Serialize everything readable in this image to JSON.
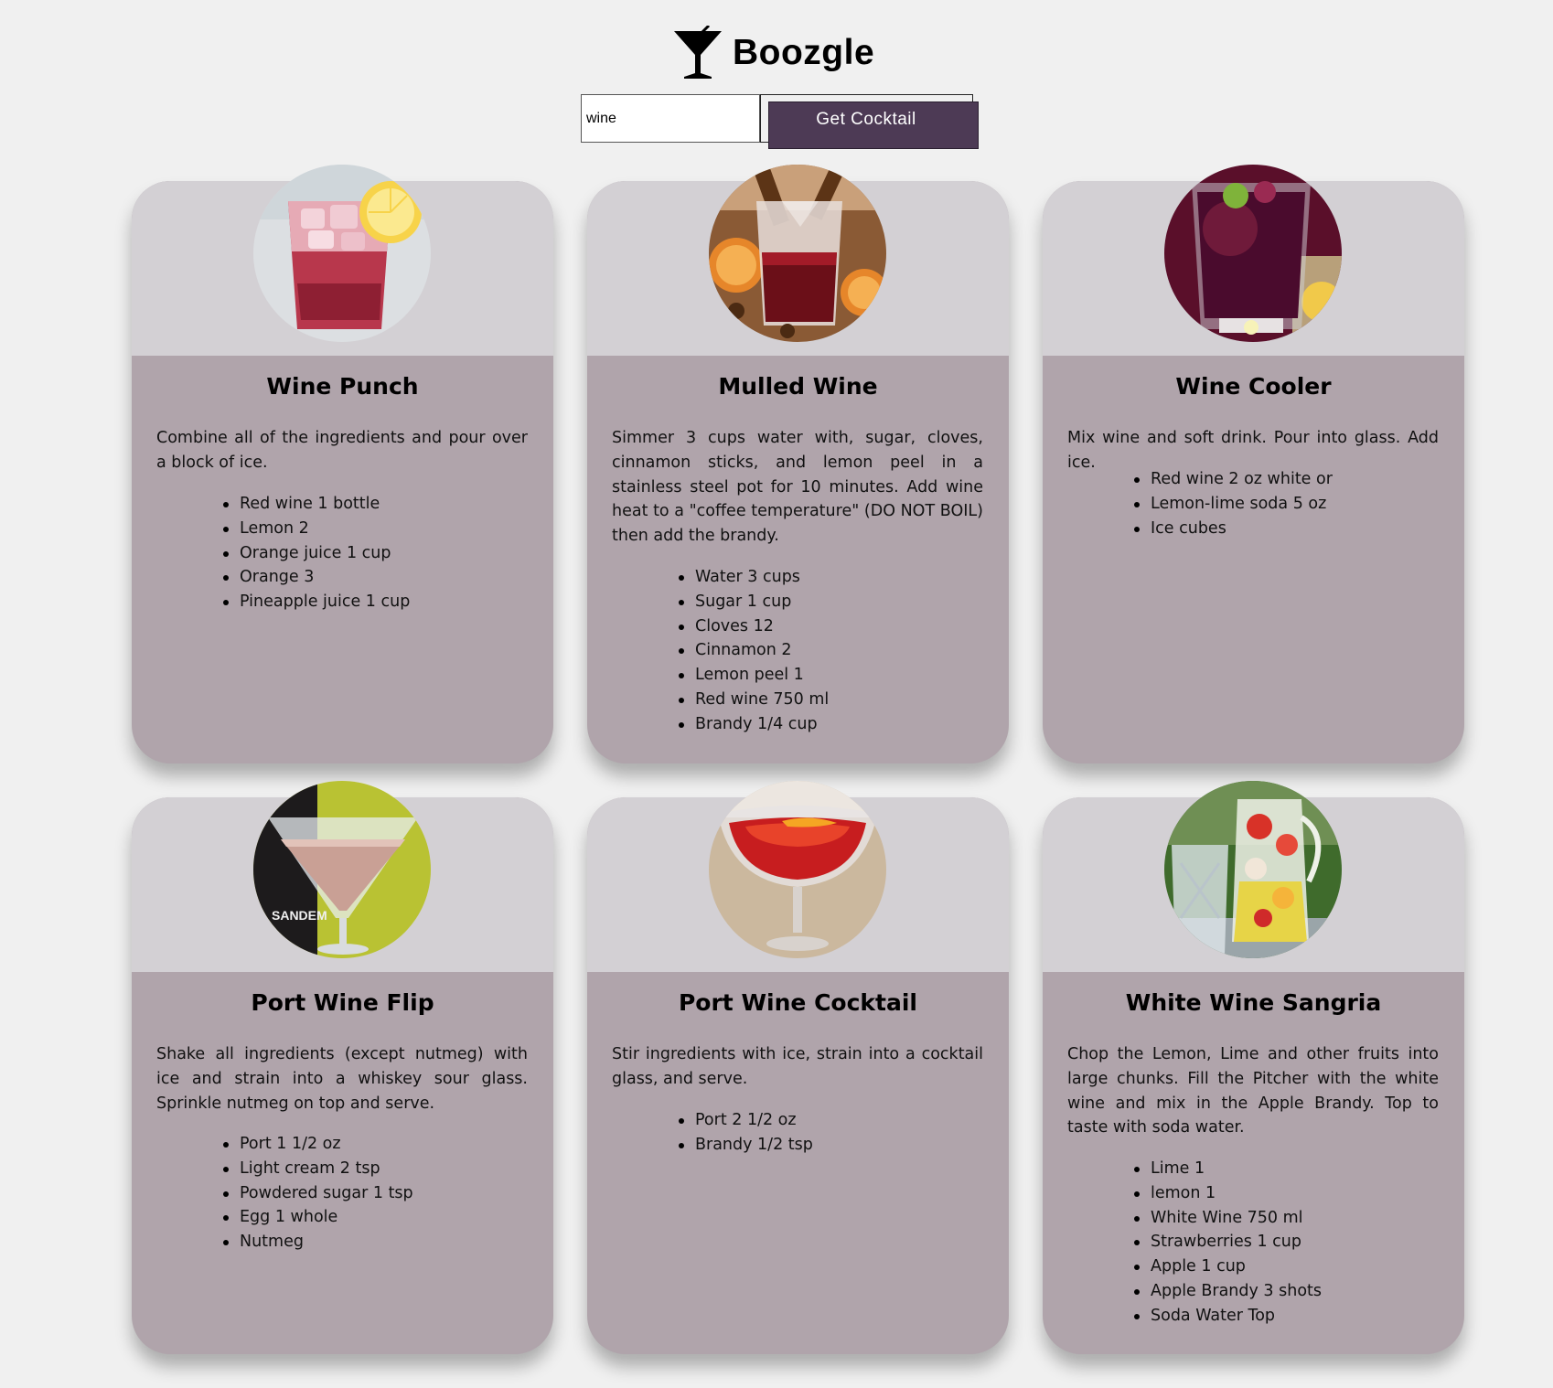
{
  "app": {
    "name": "Boozgle"
  },
  "search": {
    "value": "wine",
    "button_label": "Get Cocktail"
  },
  "cocktails": [
    {
      "name": "Wine Punch",
      "instructions": "Combine all of the ingredients and pour over a block of ice.",
      "ingredients": [
        "Red wine 1 bottle",
        "Lemon 2",
        "Orange juice 1 cup",
        "Orange 3",
        "Pineapple juice 1 cup"
      ],
      "photo": "red-punch-glass-with-lemon"
    },
    {
      "name": "Mulled Wine",
      "instructions": "Simmer 3 cups water with, sugar, cloves, cinnamon sticks, and lemon peel in a stainless steel pot for 10 minutes. Add wine heat to a \"coffee temperature\" (DO NOT BOIL) then add the brandy.",
      "ingredients": [
        "Water 3 cups",
        "Sugar 1 cup",
        "Cloves 12",
        "Cinnamon 2",
        "Lemon peel 1",
        "Red wine 750 ml",
        "Brandy 1/4 cup"
      ],
      "photo": "mulled-wine-glass-with-spices"
    },
    {
      "name": "Wine Cooler",
      "instructions": "Mix wine and soft drink. Pour into glass. Add ice.",
      "ingredients": [
        "Red wine 2 oz white or",
        "Lemon-lime soda 5 oz",
        "Ice cubes"
      ],
      "photo": "dark-red-wine-cooler-glass"
    },
    {
      "name": "Port Wine Flip",
      "instructions": "Shake all ingredients (except nutmeg) with ice and strain into a whiskey sour glass. Sprinkle nutmeg on top and serve.",
      "ingredients": [
        "Port 1 1/2 oz",
        "Light cream 2 tsp",
        "Powdered sugar 1 tsp",
        "Egg 1 whole",
        "Nutmeg"
      ],
      "photo": "creamy-martini-glass",
      "photo_label": "SANDEM"
    },
    {
      "name": "Port Wine Cocktail",
      "instructions": "Stir ingredients with ice, strain into a cocktail glass, and serve.",
      "ingredients": [
        "Port 2 1/2 oz",
        "Brandy 1/2 tsp"
      ],
      "photo": "red-coupe-glass-with-orange-peel"
    },
    {
      "name": "White Wine Sangria",
      "instructions": "Chop the Lemon, Lime and other fruits into large chunks. Fill the Pitcher with the white wine and mix in the Apple Brandy. Top to taste with soda water.",
      "ingredients": [
        "Lime 1",
        "lemon 1",
        "White Wine 750 ml",
        "Strawberries 1 cup",
        "Apple 1 cup",
        "Apple Brandy 3 shots",
        "Soda Water Top"
      ],
      "photo": "sangria-pitcher-with-fruit"
    }
  ],
  "colors": {
    "page_background": "#f0f0f0",
    "card_top": "#d3d0d4",
    "card_body": "#b0a4ab",
    "button": "#4d3a55"
  }
}
